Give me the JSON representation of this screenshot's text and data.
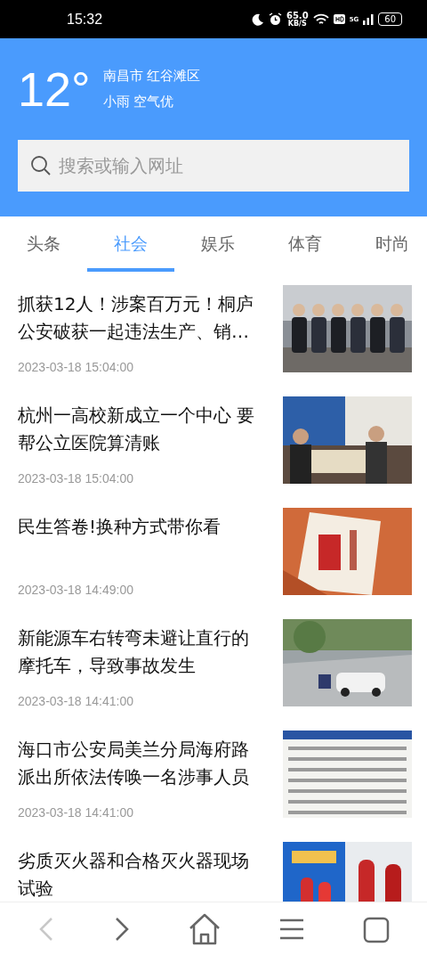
{
  "status_bar": {
    "time": "15:32",
    "speed": "65.0",
    "speed_unit": "KB/S",
    "network": "5G",
    "battery": "60"
  },
  "weather": {
    "temperature": "12°",
    "location": "南昌市 红谷滩区",
    "condition": "小雨 空气优"
  },
  "search": {
    "placeholder": "搜索或输入网址"
  },
  "tabs": [
    {
      "label": "头条",
      "selected": false
    },
    {
      "label": "社会",
      "selected": true
    },
    {
      "label": "娱乐",
      "selected": false
    },
    {
      "label": "体育",
      "selected": false
    },
    {
      "label": "时尚",
      "selected": false
    }
  ],
  "news": [
    {
      "title": "抓获12人！涉案百万元！桐庐公安破获一起违法生产、销…",
      "date": "2023-03-18 15:04:00"
    },
    {
      "title": "杭州一高校新成立一个中心 要帮公立医院算清账",
      "date": "2023-03-18 15:04:00"
    },
    {
      "title": "民生答卷!换种方式带你看",
      "date": "2023-03-18 14:49:00"
    },
    {
      "title": "新能源车右转弯未避让直行的摩托车，导致事故发生",
      "date": "2023-03-18 14:41:00"
    },
    {
      "title": "海口市公安局美兰分局海府路派出所依法传唤一名涉事人员",
      "date": "2023-03-18 14:41:00"
    },
    {
      "title": "劣质灭火器和合格灭火器现场试验"
    }
  ],
  "bottom_nav": [
    {
      "kind": "back",
      "disabled": true
    },
    {
      "kind": "forward",
      "disabled": false
    },
    {
      "kind": "home",
      "disabled": false
    },
    {
      "kind": "menu",
      "disabled": false
    },
    {
      "kind": "tabs",
      "disabled": false
    }
  ]
}
